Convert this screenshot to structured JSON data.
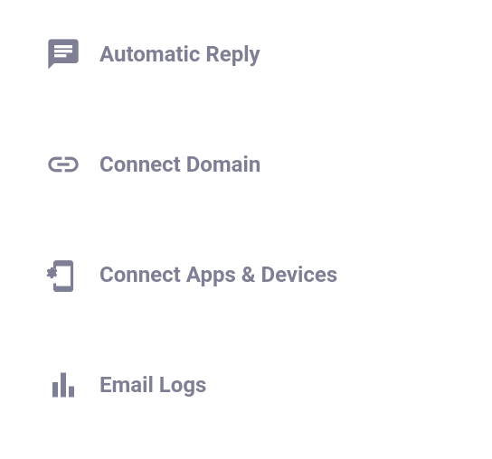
{
  "menu": {
    "items": [
      {
        "label": "Automatic Reply"
      },
      {
        "label": "Connect Domain"
      },
      {
        "label": "Connect Apps & Devices"
      },
      {
        "label": "Email Logs"
      }
    ]
  }
}
